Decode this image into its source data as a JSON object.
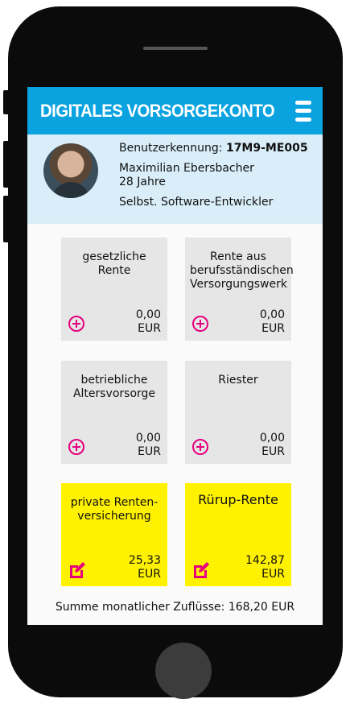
{
  "header": {
    "title": "DIGITALES VORSORGEKONTO",
    "menu_icon": "hamburger-menu-icon"
  },
  "profile": {
    "user_id_label": "Benutzerkennung:",
    "user_id": "17M9-ME005",
    "name": "Maximilian Ebersbacher",
    "age": "28 Jahre",
    "occupation": "Selbst. Software-Entwickler"
  },
  "cards": [
    {
      "label": "gesetzliche Rente",
      "amount": "0,00",
      "currency": "EUR",
      "icon": "plus-circle-icon",
      "highlight": false
    },
    {
      "label": "Rente aus berufsständischen Versorgungswerk",
      "amount": "0,00",
      "currency": "EUR",
      "icon": "plus-circle-icon",
      "highlight": false
    },
    {
      "label": "betriebliche Altersvorsorge",
      "amount": "0,00",
      "currency": "EUR",
      "icon": "plus-circle-icon",
      "highlight": false
    },
    {
      "label": "Riester",
      "amount": "0,00",
      "currency": "EUR",
      "icon": "plus-circle-icon",
      "highlight": false
    },
    {
      "label": "private Renten- versicherung",
      "amount": "25,33",
      "currency": "EUR",
      "icon": "edit-icon",
      "highlight": true
    },
    {
      "label": "Rürup-Rente",
      "amount": "142,87",
      "currency": "EUR",
      "icon": "edit-icon",
      "highlight": true
    }
  ],
  "summary": {
    "text": "Summe monatlicher Zuflüsse: 168,20 EUR"
  },
  "colors": {
    "header_bg": "#0aa3e0",
    "profile_bg": "#d9eef9",
    "card_grey": "#e6e6e6",
    "card_yellow": "#fff200",
    "accent_magenta": "#e6007e"
  }
}
